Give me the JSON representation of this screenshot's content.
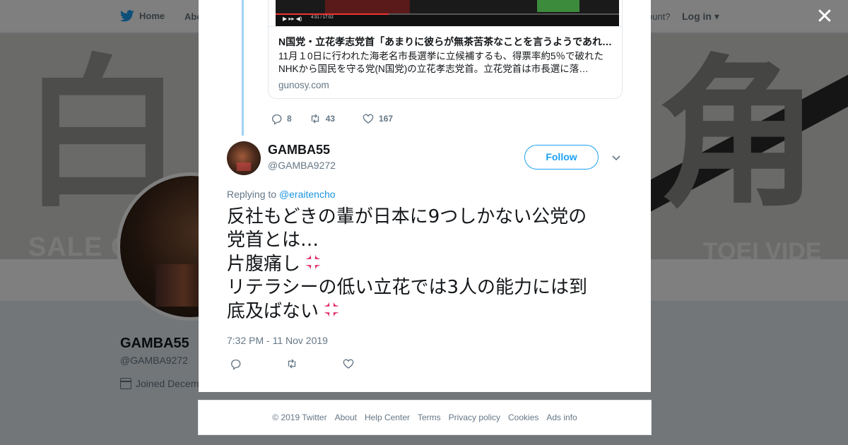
{
  "colors": {
    "accent": "#1da1f2",
    "link": "#1b95e0",
    "secondary": "#657786",
    "text": "#14171a",
    "anger": "#e0245e"
  },
  "background_page": {
    "nav": {
      "home": "Home",
      "about": "Abo",
      "account_prompt": "ccount?",
      "login": "Log in"
    },
    "banner": {
      "left_text": "白",
      "right_text": "角",
      "sale_text": "SALE C",
      "toei_text": "TOEI VIDE"
    },
    "profile": {
      "name": "GAMBA55",
      "handle": "@GAMBA9272",
      "joined": "Joined Decem"
    }
  },
  "modal": {
    "close_icon": "close-icon",
    "quoted_card": {
      "video_time": "4:31 / 17:02",
      "title": "N国党・立花孝志党首「あまりに彼らが無茶苦茶なことを言うようであれば…",
      "description": "11月１0日に行われた海老名市長選挙に立候補するも、得票率約5％で破れたNHKから国民を守る党(N国党)の立花孝志党首。立花党首は市長選に落…",
      "domain": "gunosy.com"
    },
    "parent_actions": {
      "replies": "8",
      "retweets": "43",
      "likes": "167"
    },
    "tweet": {
      "name": "GAMBA55",
      "handle": "@GAMBA9272",
      "follow_label": "Follow",
      "replying_prefix": "Replying to",
      "replying_to": "@eraitencho",
      "lines": [
        "反社もどきの輩が日本に9つしかない公党の",
        "党首とは…",
        "片腹痛し",
        "リテラシーの低い立花では3人の能力には到",
        "底及ばない"
      ],
      "timestamp": "7:32 PM - 11 Nov 2019"
    }
  },
  "footer": {
    "copyright": "© 2019 Twitter",
    "links": [
      "About",
      "Help Center",
      "Terms",
      "Privacy policy",
      "Cookies",
      "Ads info"
    ]
  }
}
